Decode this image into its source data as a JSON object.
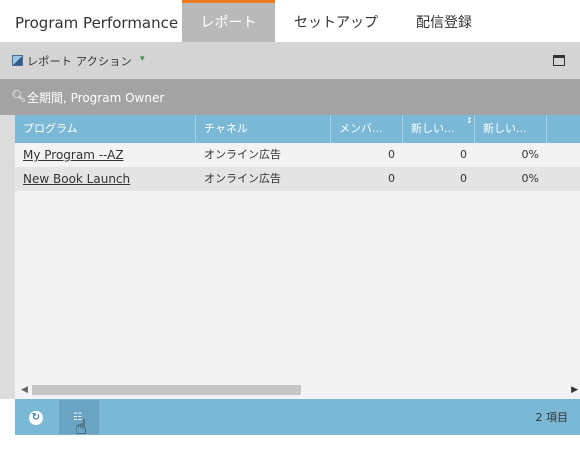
{
  "tabs": {
    "main": "Program Performance",
    "items": [
      {
        "label": "レポート"
      },
      {
        "label": "セットアップ"
      },
      {
        "label": "配信登録"
      }
    ]
  },
  "toolbar": {
    "report_actions_label": "レポート アクション",
    "caret": "▾"
  },
  "filter": {
    "text": "全期間, Program Owner"
  },
  "table": {
    "columns": [
      "プログラム",
      "チャネル",
      "メンバ...",
      "新しい...",
      "新しい..."
    ],
    "rows": [
      {
        "program": "My Program --AZ",
        "channel": "オンライン広告",
        "members": "0",
        "new1": "0",
        "new2": "0%"
      },
      {
        "program": "New Book Launch",
        "channel": "オンライン広告",
        "members": "0",
        "new1": "0",
        "new2": "0%"
      }
    ]
  },
  "footer": {
    "count": "2 項目"
  },
  "colors": {
    "accent_orange": "#f07b1f",
    "header_blue": "#7ab8d6",
    "active_tab": "#b9b9b9"
  }
}
